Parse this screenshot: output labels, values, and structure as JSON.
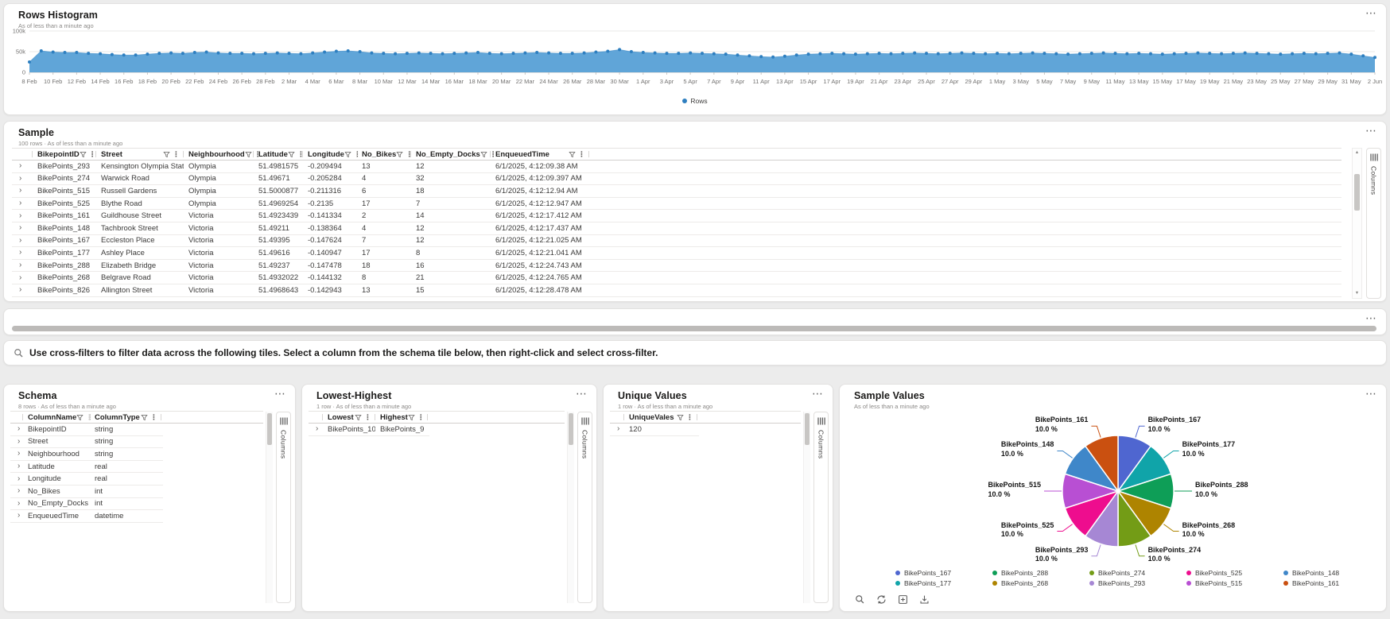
{
  "icons": {
    "more": "⋯",
    "kebab": "⋮",
    "expander": "›",
    "scroll_up": "▲",
    "scroll_down": "▼"
  },
  "cards": {
    "histogram": {
      "title": "Rows Histogram",
      "subtitle": "As of less than a minute ago",
      "legend_label": "Rows"
    },
    "sample": {
      "title": "Sample",
      "subtitle": "100 rows · As of less than a minute ago",
      "columns": [
        "BikepointID",
        "Street",
        "Neighbourhood",
        "Latitude",
        "Longitude",
        "No_Bikes",
        "No_Empty_Docks",
        "EnqueuedTime"
      ],
      "rows": [
        [
          "BikePoints_293",
          "Kensington Olympia Station",
          "Olympia",
          "51.4981575",
          "-0.209494",
          "13",
          "12",
          "6/1/2025, 4:12:09.38 AM"
        ],
        [
          "BikePoints_274",
          "Warwick Road",
          "Olympia",
          "51.49671",
          "-0.205284",
          "4",
          "32",
          "6/1/2025, 4:12:09.397 AM"
        ],
        [
          "BikePoints_515",
          "Russell Gardens",
          "Olympia",
          "51.5000877",
          "-0.211316",
          "6",
          "18",
          "6/1/2025, 4:12:12.94 AM"
        ],
        [
          "BikePoints_525",
          "Blythe Road",
          "Olympia",
          "51.4969254",
          "-0.2135",
          "17",
          "7",
          "6/1/2025, 4:12:12.947 AM"
        ],
        [
          "BikePoints_161",
          "Guildhouse Street",
          "Victoria",
          "51.4923439",
          "-0.141334",
          "2",
          "14",
          "6/1/2025, 4:12:17.412 AM"
        ],
        [
          "BikePoints_148",
          "Tachbrook Street",
          "Victoria",
          "51.49211",
          "-0.138364",
          "4",
          "12",
          "6/1/2025, 4:12:17.437 AM"
        ],
        [
          "BikePoints_167",
          "Eccleston Place",
          "Victoria",
          "51.49395",
          "-0.147624",
          "7",
          "12",
          "6/1/2025, 4:12:21.025 AM"
        ],
        [
          "BikePoints_177",
          "Ashley Place",
          "Victoria",
          "51.49616",
          "-0.140947",
          "17",
          "8",
          "6/1/2025, 4:12:21.041 AM"
        ],
        [
          "BikePoints_288",
          "Elizabeth Bridge",
          "Victoria",
          "51.49237",
          "-0.147478",
          "18",
          "16",
          "6/1/2025, 4:12:24.743 AM"
        ],
        [
          "BikePoints_268",
          "Belgrave Road",
          "Victoria",
          "51.4932022",
          "-0.144132",
          "8",
          "21",
          "6/1/2025, 4:12:24.765 AM"
        ],
        [
          "BikePoints_826",
          "Allington Street",
          "Victoria",
          "51.4968643",
          "-0.142943",
          "13",
          "15",
          "6/1/2025, 4:12:28.478 AM"
        ]
      ],
      "columns_pane_label": "Columns"
    },
    "banner": {
      "text": "Use cross-filters to filter data across the following tiles. Select a column from the schema tile below, then right-click and select cross-filter."
    },
    "schema": {
      "title": "Schema",
      "subtitle": "8 rows · As of less than a minute ago",
      "columns": [
        "ColumnName",
        "ColumnType"
      ],
      "rows": [
        [
          "BikepointID",
          "string"
        ],
        [
          "Street",
          "string"
        ],
        [
          "Neighbourhood",
          "string"
        ],
        [
          "Latitude",
          "real"
        ],
        [
          "Longitude",
          "real"
        ],
        [
          "No_Bikes",
          "int"
        ],
        [
          "No_Empty_Docks",
          "int"
        ],
        [
          "EnqueuedTime",
          "datetime"
        ]
      ],
      "columns_pane_label": "Columns"
    },
    "lowest_highest": {
      "title": "Lowest-Highest",
      "subtitle": "1 row · As of less than a minute ago",
      "columns": [
        "Lowest",
        "Highest"
      ],
      "rows": [
        [
          "BikePoints_10",
          "BikePoints_9"
        ]
      ],
      "columns_pane_label": "Columns"
    },
    "unique_values": {
      "title": "Unique Values",
      "subtitle": "1 row · As of less than a minute ago",
      "columns": [
        "UniqueVales"
      ],
      "rows": [
        [
          "120"
        ]
      ],
      "columns_pane_label": "Columns"
    },
    "sample_values": {
      "title": "Sample Values",
      "subtitle": "As of less than a minute ago",
      "legend_order": [
        "BikePoints_167",
        "BikePoints_177",
        "BikePoints_288",
        "BikePoints_268",
        "BikePoints_274",
        "BikePoints_293",
        "BikePoints_525",
        "BikePoints_515",
        "BikePoints_148",
        "BikePoints_161"
      ]
    }
  },
  "chart_data": [
    {
      "type": "area",
      "title": "Rows Histogram",
      "series": [
        {
          "name": "Rows",
          "color": "#57a0d6",
          "point_color": "#2e7fc0",
          "values": [
            25000,
            52000,
            49000,
            48000,
            48000,
            46000,
            45000,
            43000,
            42000,
            42000,
            44000,
            46000,
            47000,
            46000,
            48000,
            49000,
            47000,
            46000,
            46000,
            45000,
            46000,
            47000,
            46000,
            45000,
            47000,
            49000,
            51000,
            52000,
            50000,
            47000,
            46000,
            45000,
            46000,
            47000,
            46000,
            45000,
            46000,
            47000,
            48000,
            46000,
            45000,
            46000,
            47000,
            48000,
            47000,
            46000,
            46000,
            47000,
            49000,
            51000,
            55000,
            50000,
            48000,
            47000,
            46000,
            46000,
            47000,
            46000,
            45000,
            44000,
            42000,
            40000,
            38000,
            37000,
            39000,
            42000,
            44000,
            45000,
            46000,
            45000,
            44000,
            45000,
            46000,
            45000,
            46000,
            47000,
            46000,
            45000,
            46000,
            47000,
            46000,
            45000,
            46000,
            45000,
            46000,
            47000,
            46000,
            45000,
            44000,
            45000,
            46000,
            47000,
            46000,
            45000,
            46000,
            45000,
            44000,
            45000,
            46000,
            47000,
            46000,
            45000,
            46000,
            47000,
            46000,
            45000,
            44000,
            45000,
            46000,
            45000,
            46000,
            47000,
            44000,
            40000,
            36000
          ]
        }
      ],
      "x_tick_labels": [
        "8 Feb",
        "10 Feb",
        "12 Feb",
        "14 Feb",
        "16 Feb",
        "18 Feb",
        "20 Feb",
        "22 Feb",
        "24 Feb",
        "26 Feb",
        "28 Feb",
        "2 Mar",
        "4 Mar",
        "6 Mar",
        "8 Mar",
        "10 Mar",
        "12 Mar",
        "14 Mar",
        "16 Mar",
        "18 Mar",
        "20 Mar",
        "22 Mar",
        "24 Mar",
        "26 Mar",
        "28 Mar",
        "30 Mar",
        "1 Apr",
        "3 Apr",
        "5 Apr",
        "7 Apr",
        "9 Apr",
        "11 Apr",
        "13 Apr",
        "15 Apr",
        "17 Apr",
        "19 Apr",
        "21 Apr",
        "23 Apr",
        "25 Apr",
        "27 Apr",
        "29 Apr",
        "1 May",
        "3 May",
        "5 May",
        "7 May",
        "9 May",
        "11 May",
        "13 May",
        "15 May",
        "17 May",
        "19 May",
        "21 May",
        "23 May",
        "25 May",
        "27 May",
        "29 May",
        "31 May",
        "2 Jun"
      ],
      "ylim": [
        0,
        100000
      ],
      "y_tick_labels": [
        "0",
        "50k",
        "100k"
      ],
      "grid": true,
      "legend_position": "bottom-center"
    },
    {
      "type": "pie",
      "title": "Sample Values",
      "labels": [
        "BikePoints_167",
        "BikePoints_177",
        "BikePoints_288",
        "BikePoints_268",
        "BikePoints_274",
        "BikePoints_293",
        "BikePoints_525",
        "BikePoints_515",
        "BikePoints_148",
        "BikePoints_161"
      ],
      "values": [
        10,
        10,
        10,
        10,
        10,
        10,
        10,
        10,
        10,
        10
      ],
      "percent_display": "10.0 %",
      "colors": [
        "#4f66d0",
        "#10a4a9",
        "#0e9e57",
        "#ae8400",
        "#739c16",
        "#a687d4",
        "#ee0d8e",
        "#b84fd3",
        "#3f87c9",
        "#ca5010"
      ],
      "legend_position": "bottom"
    }
  ]
}
